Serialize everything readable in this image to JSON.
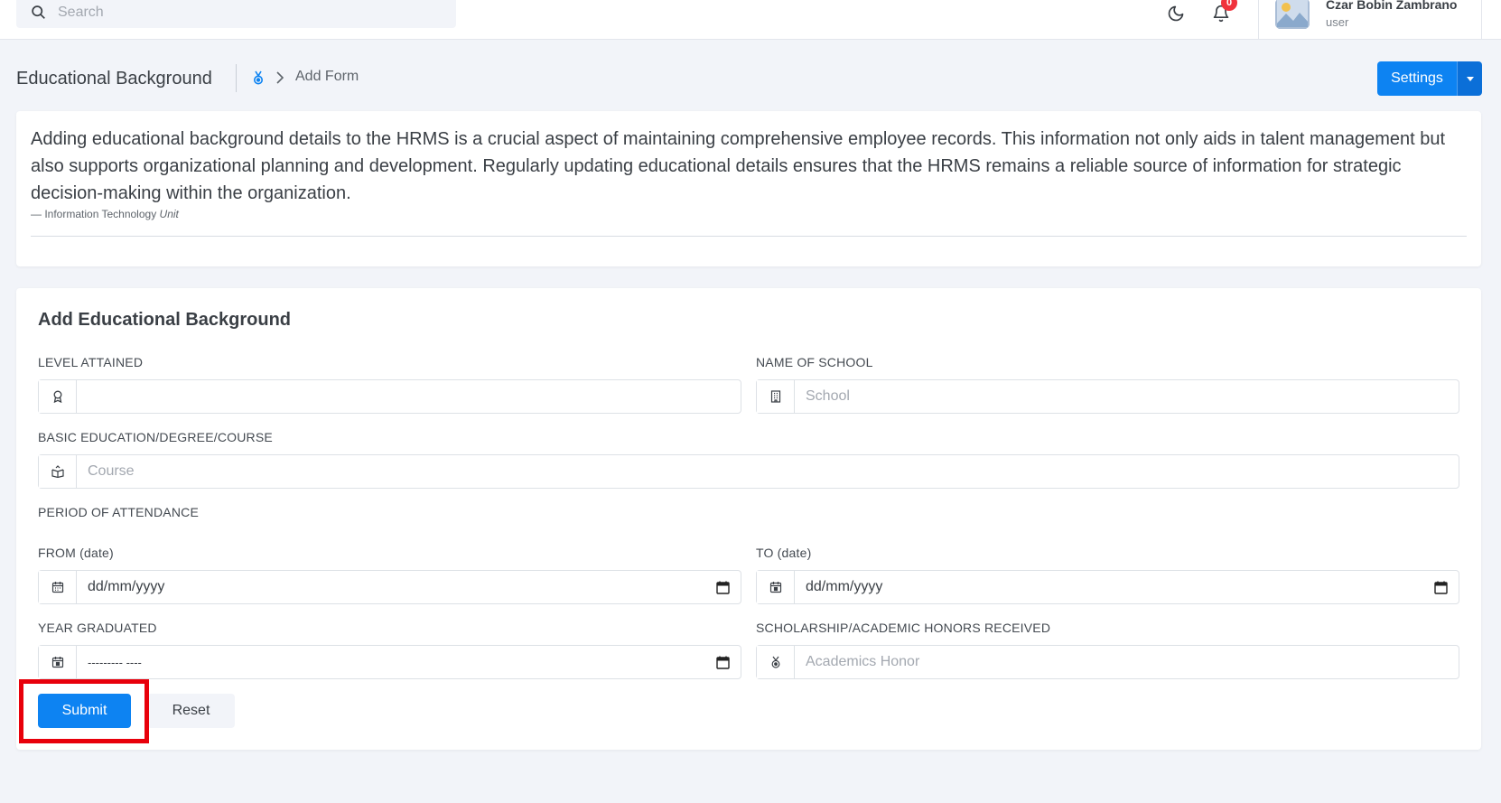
{
  "topbar": {
    "search_placeholder": "Search",
    "notification_count": "0",
    "user_name": "Czar Bobin Zambrano",
    "user_role": "user",
    "icons": [
      "search-icon",
      "moon-icon",
      "bell-icon",
      "avatar-image"
    ]
  },
  "header": {
    "title": "Educational Background",
    "breadcrumb_current": "Add Form",
    "settings_label": "Settings"
  },
  "info": {
    "text": "Adding educational background details to the HRMS is a crucial aspect of maintaining comprehensive employee records. This information not only aids in talent management but also supports organizational planning and development. Regularly updating educational details ensures that the HRMS remains a reliable source of information for strategic decision-making within the organization.",
    "footer_prefix": "—  Information Technology",
    "footer_suffix": "Unit"
  },
  "form": {
    "title": "Add Educational Background",
    "level_label": "LEVEL ATTAINED",
    "level_value": "",
    "school_label": "NAME OF SCHOOL",
    "school_placeholder": "School",
    "course_label": "BASIC EDUCATION/DEGREE/COURSE",
    "course_placeholder": "Course",
    "period_label": "PERIOD OF ATTENDANCE",
    "from_label": "FROM (date)",
    "from_value": "dd/mm/yyyy",
    "to_label": "TO (date)",
    "to_value": "dd/mm/yyyy",
    "year_label": "YEAR GRADUATED",
    "year_value": "--------- ----",
    "honors_label": "SCHOLARSHIP/ACADEMIC HONORS RECEIVED",
    "honors_placeholder": "Academics Honor",
    "submit_label": "Submit",
    "reset_label": "Reset"
  },
  "colors": {
    "primary": "#0d83f2",
    "badge": "#f0323c",
    "highlight": "#e8000b",
    "background": "#f2f4f9"
  }
}
